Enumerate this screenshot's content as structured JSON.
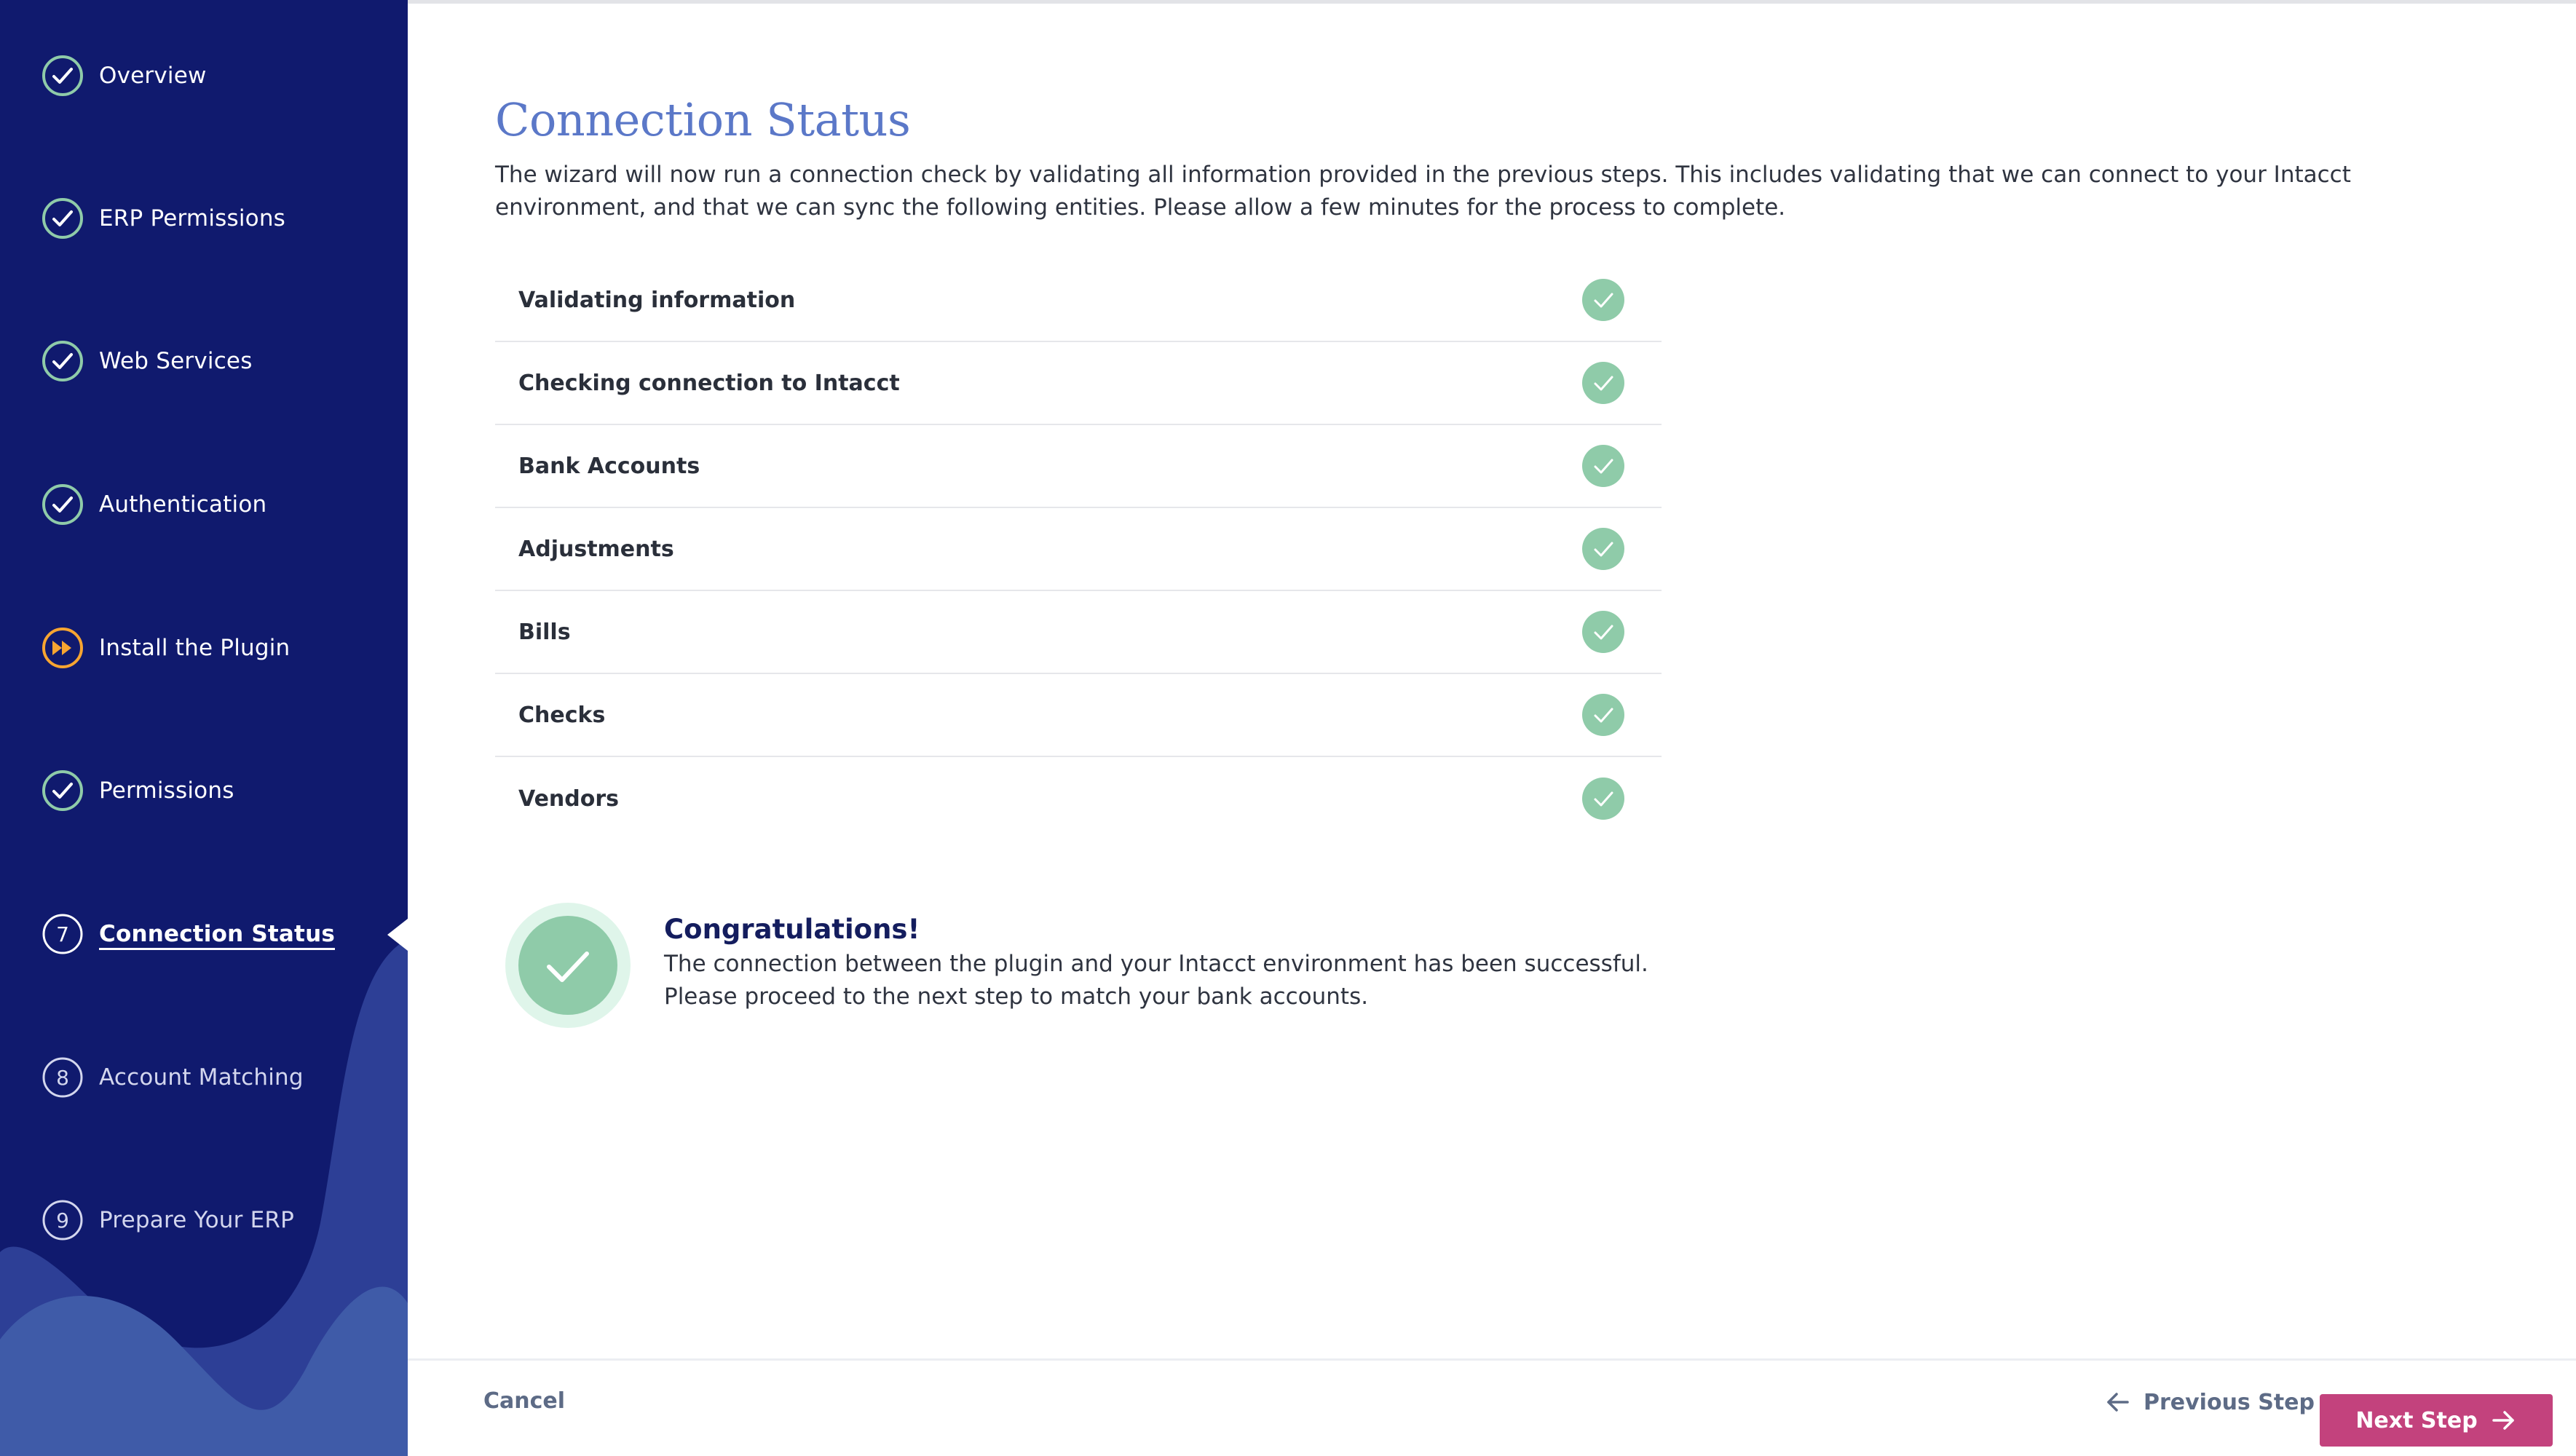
{
  "colors": {
    "sidebar_bg": "#101a6e",
    "wave_mid": "#2d3f96",
    "wave_light": "#3f5ba8",
    "check_green": "#8fcba9",
    "current_step_orange": "#f7a531",
    "title_blue": "#5b78c8",
    "primary_button": "#c3427d"
  },
  "sidebar": {
    "steps": [
      {
        "label": "Overview",
        "state": "completed",
        "icon": "check-circle-icon"
      },
      {
        "label": "ERP Permissions",
        "state": "completed",
        "icon": "check-circle-icon"
      },
      {
        "label": "Web Services",
        "state": "completed",
        "icon": "check-circle-icon"
      },
      {
        "label": "Authentication",
        "state": "completed",
        "icon": "check-circle-icon"
      },
      {
        "label": "Install the Plugin",
        "state": "in-progress",
        "icon": "fast-forward-icon"
      },
      {
        "label": "Permissions",
        "state": "completed",
        "icon": "check-circle-icon"
      },
      {
        "label": "Connection Status",
        "state": "active",
        "number": "7"
      },
      {
        "label": "Account Matching",
        "state": "pending",
        "number": "8"
      },
      {
        "label": "Prepare Your ERP",
        "state": "pending",
        "number": "9"
      }
    ]
  },
  "main": {
    "title": "Connection Status",
    "description": "The wizard will now run a connection check by validating all information provided in the previous steps. This includes validating that we can connect to your Intacct environment, and that we can sync the following entities. Please allow a few minutes for the process to complete.",
    "checks": [
      {
        "label": "Validating information",
        "status": "success"
      },
      {
        "label": "Checking connection to Intacct",
        "status": "success"
      },
      {
        "label": "Bank Accounts",
        "status": "success"
      },
      {
        "label": "Adjustments",
        "status": "success"
      },
      {
        "label": "Bills",
        "status": "success"
      },
      {
        "label": "Checks",
        "status": "success"
      },
      {
        "label": "Vendors",
        "status": "success"
      }
    ],
    "congrats": {
      "title": "Congratulations!",
      "line1": "The connection between the plugin and your Intacct environment has been successful.",
      "line2": "Please proceed to the next step to match your bank accounts."
    }
  },
  "footer": {
    "cancel_label": "Cancel",
    "previous_label": "Previous Step",
    "next_label": "Next Step"
  }
}
